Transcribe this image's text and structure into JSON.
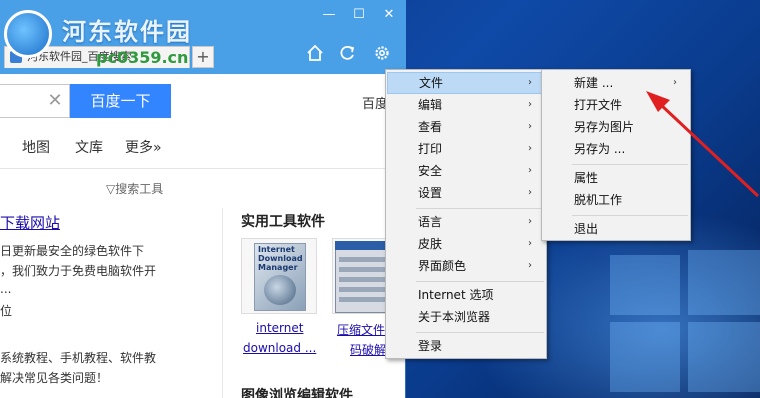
{
  "watermark": {
    "title": "河东软件园",
    "url": "pc0359.cn"
  },
  "window": {
    "tab_title": "河东软件园_百度搜索",
    "controls": {
      "minimize": "—",
      "maximize": "☐",
      "close": "✕"
    },
    "new_tab": "+"
  },
  "toolbar_icons": [
    "home-icon",
    "refresh-icon",
    "settings-icon"
  ],
  "search": {
    "button_label": "百度一下",
    "clear_glyph": "✕",
    "baidu_link": "百度"
  },
  "nav": {
    "items": [
      "地图",
      "文库",
      "更多»"
    ]
  },
  "search_tools": "▽搜索工具",
  "result": {
    "title": "下载网站",
    "lines": [
      "日更新最安全的绿色软件下",
      "，我们致力于免费电脑软件开",
      "...",
      "位",
      "系统教程、手机教程、软件教",
      "解决常见各类问题！"
    ]
  },
  "right_panel": {
    "title": "实用工具软件",
    "items": [
      {
        "label_lines": [
          "internet",
          "download ..."
        ],
        "thumb_text": [
          "Internet",
          "Download",
          "Manager"
        ]
      },
      {
        "label_lines": [
          "压缩文件",
          "码破解"
        ]
      }
    ],
    "bottom_title": "图像浏览编辑软件"
  },
  "main_menu": {
    "items": [
      {
        "label": "文件",
        "submenu": true,
        "highlighted": true
      },
      {
        "label": "编辑",
        "submenu": true
      },
      {
        "label": "查看",
        "submenu": true
      },
      {
        "label": "打印",
        "submenu": true
      },
      {
        "label": "安全",
        "submenu": true
      },
      {
        "label": "设置",
        "submenu": true
      },
      {
        "label": "语言",
        "submenu": true
      },
      {
        "label": "皮肤",
        "submenu": true
      },
      {
        "label": "界面颜色",
        "submenu": true
      },
      {
        "label": "Internet 选项",
        "submenu": false
      },
      {
        "label": "关于本浏览器",
        "submenu": false
      },
      {
        "label": "登录",
        "submenu": false
      }
    ]
  },
  "file_submenu": {
    "items": [
      {
        "label": "新建 ...",
        "submenu": true
      },
      {
        "label": "打开文件",
        "submenu": false
      },
      {
        "label": "另存为图片",
        "submenu": false
      },
      {
        "label": "另存为 ...",
        "submenu": false
      },
      {
        "label": "属性",
        "submenu": false
      },
      {
        "label": "脱机工作",
        "submenu": false
      },
      {
        "label": "退出",
        "submenu": false
      }
    ]
  },
  "submenu_glyph": "›",
  "colors": {
    "titlebar": "#4aa0e6",
    "menu_highlight": "#bcdaf6",
    "search_button": "#3385ff",
    "annotation_arrow": "#e02020"
  }
}
